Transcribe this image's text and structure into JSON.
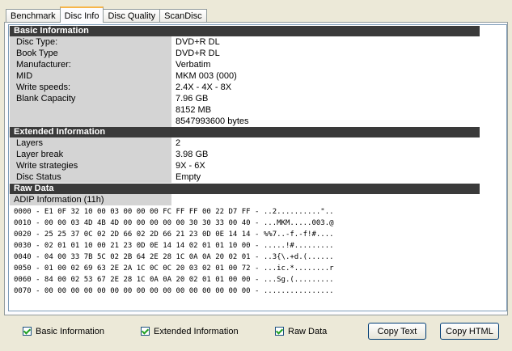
{
  "tabs": [
    "Benchmark",
    "Disc Info",
    "Disc Quality",
    "ScanDisc"
  ],
  "basic": {
    "header": "Basic Information",
    "rows": [
      {
        "label": "Disc Type:",
        "values": [
          "DVD+R DL"
        ]
      },
      {
        "label": "Book Type",
        "values": [
          "DVD+R DL"
        ]
      },
      {
        "label": "Manufacturer:",
        "values": [
          "Verbatim"
        ]
      },
      {
        "label": "MID",
        "values": [
          "MKM 003 (000)"
        ]
      },
      {
        "label": "Write speeds:",
        "values": [
          "2.4X - 4X - 8X"
        ]
      },
      {
        "label": "Blank Capacity",
        "values": [
          "7.96 GB",
          "8152 MB",
          "8547993600 bytes"
        ]
      }
    ]
  },
  "extended": {
    "header": "Extended Information",
    "rows": [
      {
        "label": "Layers",
        "values": [
          "2"
        ]
      },
      {
        "label": "Layer break",
        "values": [
          "3.98 GB"
        ]
      },
      {
        "label": "Write strategies",
        "values": [
          "9X - 6X"
        ]
      },
      {
        "label": "Disc Status",
        "values": [
          "Empty"
        ]
      }
    ]
  },
  "raw": {
    "header": "Raw Data",
    "subheader": "ADIP Information (11h)",
    "lines": [
      "0000 - E1 0F 32 10 00 03 00 00 00 FC FF FF 00 22 D7 FF - ..2..........\"..",
      "0010 - 00 00 03 4D 4B 4D 00 00 00 00 00 30 30 33 00 40 - ...MKM.....003.@",
      "0020 - 25 25 37 0C 02 2D 66 02 2D 66 21 23 0D 0E 14 14 - %%7..-f.-f!#....",
      "0030 - 02 01 01 10 00 21 23 0D 0E 14 14 02 01 01 10 00 - .....!#.........",
      "0040 - 04 00 33 7B 5C 02 2B 64 2E 28 1C 0A 0A 20 02 01 - ..3{\\.+d.(......",
      "0050 - 01 00 02 69 63 2E 2A 1C 0C 0C 20 03 02 01 00 72 - ...ic.*........r",
      "0060 - 84 00 02 53 67 2E 28 1C 0A 0A 20 02 01 01 00 00 - ...Sg.(.........",
      "0070 - 00 00 00 00 00 00 00 00 00 00 00 00 00 00 00 00 - ................"
    ]
  },
  "options": {
    "basic_label": "Basic Information",
    "extended_label": "Extended Information",
    "raw_label": "Raw Data",
    "copy_text_label": "Copy Text",
    "copy_html_label": "Copy HTML"
  },
  "icons": {
    "checkbox": "checkmark-icon"
  },
  "colors": {
    "section_header": "#3a3a3a",
    "label_bg": "#d4d4d4",
    "active_tab_accent": "#f7b64a"
  }
}
